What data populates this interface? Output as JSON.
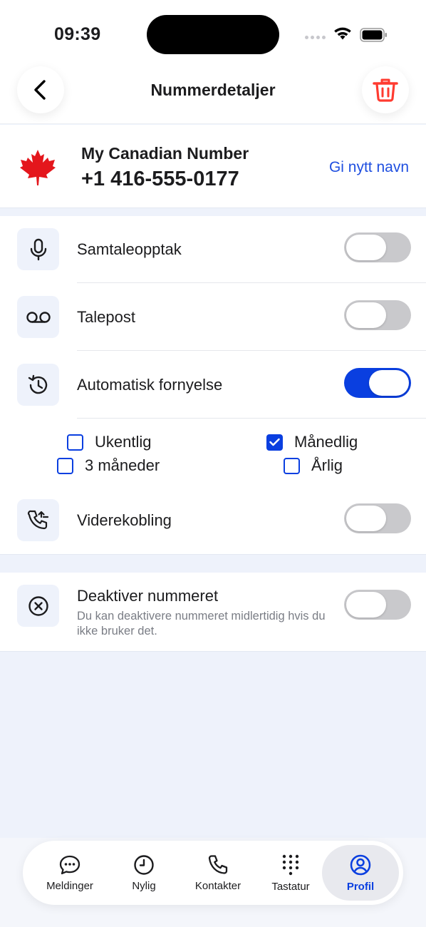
{
  "status": {
    "time": "09:39"
  },
  "header": {
    "title": "Nummerdetaljer",
    "back_icon": "chevron-left-icon",
    "delete_icon": "trash-icon",
    "accent": "#ff3b30"
  },
  "number": {
    "name": "My Canadian Number",
    "value": "+1 416-555-0177",
    "rename_label": "Gi nytt navn",
    "flag_icon": "canada-flag-icon"
  },
  "settings": {
    "recording": {
      "label": "Samtaleopptak",
      "icon": "microphone-icon",
      "enabled": false
    },
    "voicemail": {
      "label": "Talepost",
      "icon": "voicemail-icon",
      "enabled": false
    },
    "auto_renew": {
      "label": "Automatisk fornyelse",
      "icon": "history-icon",
      "enabled": true
    },
    "renew_options": [
      {
        "label": "Ukentlig",
        "checked": false
      },
      {
        "label": "Månedlig",
        "checked": true
      },
      {
        "label": "3 måneder",
        "checked": false
      },
      {
        "label": "Årlig",
        "checked": false
      }
    ],
    "forwarding": {
      "label": "Viderekobling",
      "icon": "phone-forward-icon",
      "enabled": false
    }
  },
  "deactivate": {
    "label": "Deaktiver nummeret",
    "description": "Du kan deaktivere nummeret midlertidig hvis du ikke bruker det.",
    "icon": "x-circle-icon",
    "enabled": false
  },
  "tabs": [
    {
      "label": "Meldinger",
      "icon": "chat-icon",
      "active": false
    },
    {
      "label": "Nylig",
      "icon": "clock-icon",
      "active": false
    },
    {
      "label": "Kontakter",
      "icon": "phone-icon",
      "active": false
    },
    {
      "label": "Tastatur",
      "icon": "keypad-icon",
      "active": false
    },
    {
      "label": "Profil",
      "icon": "profile-icon",
      "active": true
    }
  ],
  "colors": {
    "accent": "#0a3fe0",
    "link": "#1f4fe0",
    "background": "#eef2fb",
    "danger": "#ff3b30"
  }
}
